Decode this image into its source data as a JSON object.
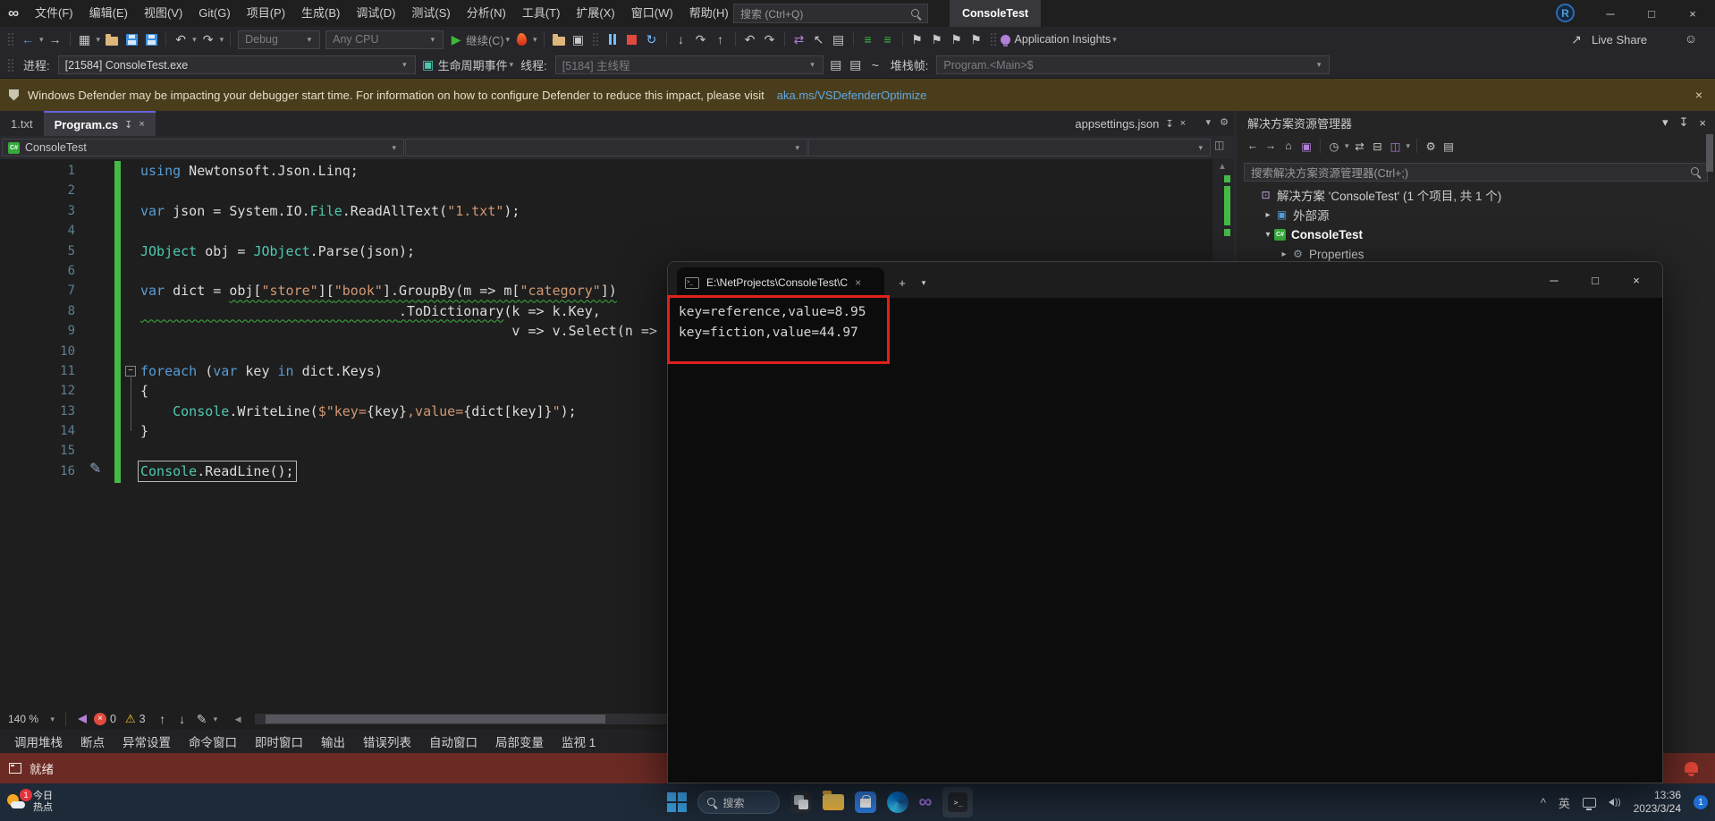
{
  "colors": {
    "accent_tab": "#6563e0",
    "change_bar_green": "#45b945",
    "squiggle_green": "#3fae3f",
    "statusbar_debug": "#6b2a24",
    "annotation_red": "#e0201e",
    "link_blue": "#61a8e0"
  },
  "titlebar": {
    "menus": [
      "文件(F)",
      "编辑(E)",
      "视图(V)",
      "Git(G)",
      "项目(P)",
      "生成(B)",
      "调试(D)",
      "测试(S)",
      "分析(N)",
      "工具(T)",
      "扩展(X)",
      "窗口(W)",
      "帮助(H)"
    ],
    "search_placeholder": "搜索 (Ctrl+Q)",
    "window_title": "ConsoleTest",
    "avatar_initial": "R"
  },
  "toolbar": {
    "config": "Debug",
    "platform": "Any CPU",
    "continue_label": "继续(C)",
    "app_insights": "Application Insights",
    "live_share": "Live Share"
  },
  "debugbar": {
    "process_label": "进程:",
    "process_value": "[21584] ConsoleTest.exe",
    "lifecycle_label": "生命周期事件",
    "thread_label": "线程:",
    "thread_value": "[5184] 主线程",
    "stack_label": "堆栈帧:",
    "stack_value": "Program.<Main>$"
  },
  "infobar": {
    "message": "Windows Defender may be impacting your debugger start time. For information on how to configure Defender to reduce this impact, please visit",
    "link": "aka.ms/VSDefenderOptimize"
  },
  "editor": {
    "tab_left1": "1.txt",
    "tab_left2": "Program.cs",
    "tab_right": "appsettings.json",
    "breadcrumb_project": "ConsoleTest",
    "zoom_level": "140 %",
    "error_count": "0",
    "warning_count": "3",
    "code": [
      {
        "n": "1",
        "spans": [
          {
            "t": "using",
            "c": "k"
          },
          {
            "t": " Newtonsoft.Json.Linq;",
            "c": "p"
          }
        ]
      },
      {
        "n": "2",
        "spans": []
      },
      {
        "n": "3",
        "spans": [
          {
            "t": "var",
            "c": "k"
          },
          {
            "t": " json = System.IO.",
            "c": "p"
          },
          {
            "t": "File",
            "c": "t"
          },
          {
            "t": ".ReadAllText(",
            "c": "p"
          },
          {
            "t": "\"1.txt\"",
            "c": "s"
          },
          {
            "t": ");",
            "c": "p"
          }
        ]
      },
      {
        "n": "4",
        "spans": []
      },
      {
        "n": "5",
        "spans": [
          {
            "t": "JObject",
            "c": "t"
          },
          {
            "t": " obj = ",
            "c": "p"
          },
          {
            "t": "JObject",
            "c": "t"
          },
          {
            "t": ".Parse(json);",
            "c": "p"
          }
        ]
      },
      {
        "n": "6",
        "spans": []
      },
      {
        "n": "7",
        "spans": [
          {
            "t": "var",
            "c": "k"
          },
          {
            "t": " dict = ",
            "c": "p"
          },
          {
            "t": "obj[",
            "c": "p",
            "u": 1
          },
          {
            "t": "\"store\"",
            "c": "s",
            "u": 1
          },
          {
            "t": "][",
            "c": "p",
            "u": 1
          },
          {
            "t": "\"book\"",
            "c": "s",
            "u": 1
          },
          {
            "t": "].GroupBy(m => m[",
            "c": "p",
            "u": 1
          },
          {
            "t": "\"category\"",
            "c": "s",
            "u": 1
          },
          {
            "t": "])",
            "c": "p",
            "u": 1
          }
        ]
      },
      {
        "n": "8",
        "spans": [
          {
            "t": "                                ",
            "c": "p",
            "u": 1
          },
          {
            "t": ".ToDictionary",
            "c": "p",
            "u": 1
          },
          {
            "t": "(k => k.Key,",
            "c": "p"
          }
        ]
      },
      {
        "n": "9",
        "spans": [
          {
            "t": "                                              ",
            "c": "p"
          },
          {
            "t": "v => v.Select(n =>",
            "c": "p"
          }
        ]
      },
      {
        "n": "10",
        "spans": []
      },
      {
        "n": "11",
        "fold": true,
        "spans": [
          {
            "t": "foreach",
            "c": "k"
          },
          {
            "t": " (",
            "c": "p"
          },
          {
            "t": "var",
            "c": "k"
          },
          {
            "t": " key ",
            "c": "p"
          },
          {
            "t": "in",
            "c": "k"
          },
          {
            "t": " dict.Keys)",
            "c": "p"
          }
        ]
      },
      {
        "n": "12",
        "spans": [
          {
            "t": "{",
            "c": "p"
          }
        ]
      },
      {
        "n": "13",
        "spans": [
          {
            "t": "    ",
            "c": "p"
          },
          {
            "t": "Console",
            "c": "t"
          },
          {
            "t": ".WriteLine(",
            "c": "p"
          },
          {
            "t": "$\"key=",
            "c": "s"
          },
          {
            "t": "{key}",
            "c": "p"
          },
          {
            "t": ",value=",
            "c": "s"
          },
          {
            "t": "{dict[key]}",
            "c": "p"
          },
          {
            "t": "\"",
            "c": "s"
          },
          {
            "t": ");",
            "c": "p"
          }
        ]
      },
      {
        "n": "14",
        "spans": [
          {
            "t": "}",
            "c": "p"
          }
        ]
      },
      {
        "n": "15",
        "spans": []
      },
      {
        "n": "16",
        "box": true,
        "pencil": true,
        "spans": [
          {
            "t": "Console",
            "c": "t"
          },
          {
            "t": ".ReadLine();",
            "c": "p"
          }
        ]
      }
    ]
  },
  "console_window": {
    "tab_title": "E:\\NetProjects\\ConsoleTest\\C",
    "output": [
      "key=reference,value=8.95",
      "key=fiction,value=44.97"
    ]
  },
  "solution_explorer": {
    "title": "解决方案资源管理器",
    "search_placeholder": "搜索解决方案资源管理器(Ctrl+;)",
    "items": [
      {
        "label": "解决方案 'ConsoleTest' (1 个项目, 共 1 个)",
        "icon": "solution",
        "depth": 0
      },
      {
        "label": "外部源",
        "icon": "external",
        "depth": 1,
        "arrow": "collapsed"
      },
      {
        "label": "ConsoleTest",
        "icon": "csproj",
        "depth": 1,
        "arrow": "expanded",
        "bold": true
      },
      {
        "label": "Properties",
        "icon": "properties",
        "depth": 2,
        "arrow": "collapsed"
      }
    ]
  },
  "bottom_tabs": [
    "调用堆栈",
    "断点",
    "异常设置",
    "命令窗口",
    "即时窗口",
    "输出",
    "错误列表",
    "自动窗口",
    "局部变量",
    "监视 1"
  ],
  "statusbar": {
    "ready": "就绪"
  },
  "taskbar": {
    "widget_line1": "今日",
    "widget_line2": "热点",
    "widget_badge": "1",
    "search_label": "搜索",
    "ime": "英",
    "time": "13:36",
    "date": "2023/3/24",
    "notification_badge": "1"
  },
  "icons": {
    "vs-logo": "∞",
    "back": "←",
    "forward": "→",
    "dropdown": "▾",
    "play": "▶",
    "restart": "↻",
    "step-into": "↓",
    "step-over": "↷",
    "step-out": "↑",
    "undo": "↶",
    "redo": "↷",
    "close": "×",
    "minimize": "─",
    "maximize": "□",
    "pin": "↧",
    "gear": "⚙",
    "split": "◫",
    "home": "⌂",
    "clock": "◷",
    "sync": "⇄",
    "collapse-all": "⊟",
    "doc": "▤",
    "window": "▣",
    "bookmark": "⚑",
    "warning": "⚠",
    "pencil": "✎",
    "scroll-left": "◀",
    "up-arrow": "↑",
    "down-arrow": "↓",
    "chevron-up": "^",
    "plus": "+",
    "expander-collapsed": "▸",
    "expander-expanded": "▾",
    "new-project": "▦",
    "clipboard": "▤",
    "format": "≡",
    "nav-cursor": "↖",
    "code-map": "⇄",
    "live-share": "↗",
    "feedback": "☺",
    "up-tri": "▲",
    "csharp-badge": "C#",
    "terminal-prompt": ">_"
  }
}
